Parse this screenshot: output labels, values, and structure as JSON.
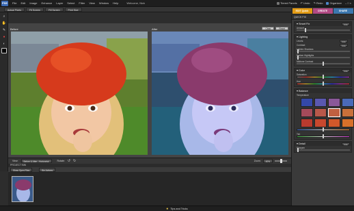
{
  "menubar": {
    "logo": "PSE",
    "items": [
      "File",
      "Edit",
      "Image",
      "Enhance",
      "Layer",
      "Select",
      "Filter",
      "View",
      "Window",
      "Help"
    ],
    "title": "Welcome, Nick",
    "right": {
      "panels": "Tiered Panels",
      "undo": "Undo",
      "redo": "Redo",
      "organizer": "Organizer"
    }
  },
  "toolbar": {
    "buttons": [
      "Actual Pixels",
      "Fit Screen",
      "Fill Screen",
      "Print Size"
    ]
  },
  "modes": {
    "edit": "EDIT Quick",
    "create": "CREATE",
    "share": "SHARE"
  },
  "canvas": {
    "before_label": "Before",
    "after_label": "After",
    "reset_label": "Reset",
    "clear_label": "Clear"
  },
  "viewbar": {
    "view_label": "View:",
    "view_value": "Before & After - Horizontal",
    "rotate_label": "Rotate:",
    "zoom_label": "Zoom:",
    "zoom_value": "40%"
  },
  "bin": {
    "header": "PROJECT BIN",
    "show_open_files": "Show Open Files",
    "bin_actions": "Bin Actions"
  },
  "status": {
    "tips": "Tips and Tricks"
  },
  "panel": {
    "title": "QUICK FIX",
    "sections": {
      "smart_fix": {
        "title": "Smart Fix",
        "auto": "Auto",
        "amount_label": "Amount",
        "amount_level": 0.15
      },
      "lighting": {
        "title": "Lighting",
        "levels_label": "Levels:",
        "levels_auto": "Auto",
        "contrast_label": "Contrast:",
        "contrast_auto": "Auto",
        "lighten_label": "Lighten Shadows",
        "lighten_level": 0.0,
        "darken_label": "Darken Highlights",
        "darken_level": 0.0,
        "midtone_label": "Midtone Contrast",
        "midtone_level": 0.5
      },
      "color": {
        "title": "Color",
        "auto": "Auto",
        "saturation_label": "Saturation",
        "saturation_level": 0.5,
        "hue_label": "Hue",
        "hue_level": 0.5
      },
      "balance": {
        "title": "Balance",
        "temperature_label": "Temperature",
        "temperature_level": 0.5,
        "tint_label": "Tint",
        "tint_level": 0.5
      },
      "detail": {
        "title": "Detail",
        "auto": "Auto",
        "sharpen_label": "Sharpen",
        "sharpen_level": 0.0
      }
    }
  },
  "colors": {
    "edit_tab": "#e29b15",
    "create_tab": "#b24a84",
    "share_tab": "#3c77ae",
    "bg": "#2d2d2d"
  }
}
